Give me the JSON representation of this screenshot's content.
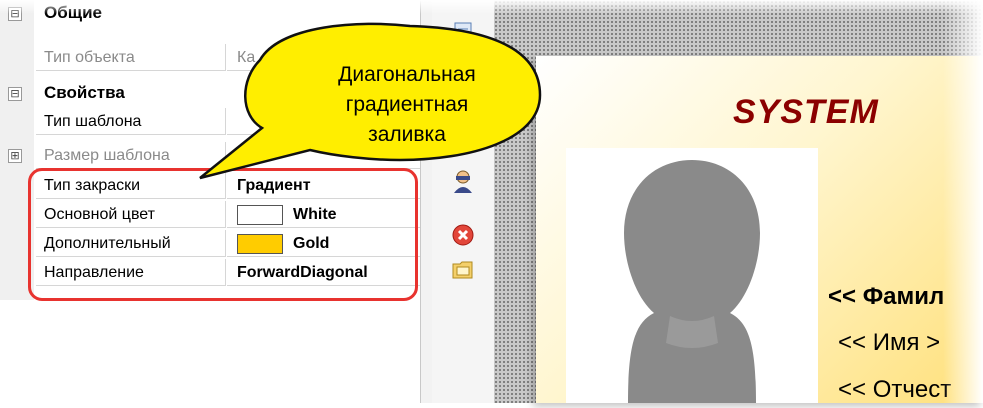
{
  "property_grid": {
    "rows": [
      {
        "kind": "category",
        "toggle": "⊟",
        "label": "Общие"
      },
      {
        "kind": "property",
        "name": "Тип объекта",
        "value": "Ка",
        "disabled": true
      },
      {
        "kind": "category",
        "toggle": "⊟",
        "label": "Свойства"
      },
      {
        "kind": "property",
        "name": "Тип шаблона",
        "value": ""
      },
      {
        "kind": "property",
        "toggle": "⊞",
        "name": "Размер шаблона",
        "value": "",
        "disabled": true
      },
      {
        "kind": "property",
        "name": "Тип закраски",
        "value": "Градиент"
      },
      {
        "kind": "property",
        "name": "Основной цвет",
        "value": "White",
        "swatch": "#ffffff"
      },
      {
        "kind": "property",
        "name": "Дополнительный",
        "value": "Gold",
        "swatch": "#ffcc00"
      },
      {
        "kind": "property",
        "name": "Направление",
        "value": "ForwardDiagonal"
      }
    ],
    "highlight_color": "#e8332f"
  },
  "callout": {
    "lines": [
      "Диагональная",
      "градиентная",
      "заливка"
    ],
    "fill": "#ffee00"
  },
  "toolbar": {
    "icons": [
      "document-icon",
      "person-icon",
      "delete-icon",
      "folder-icon"
    ]
  },
  "card": {
    "title": "SYSTEM",
    "title_color": "#8b0000",
    "fields": [
      "<< Фамил",
      "<< Имя >",
      "<< Отчест"
    ]
  }
}
